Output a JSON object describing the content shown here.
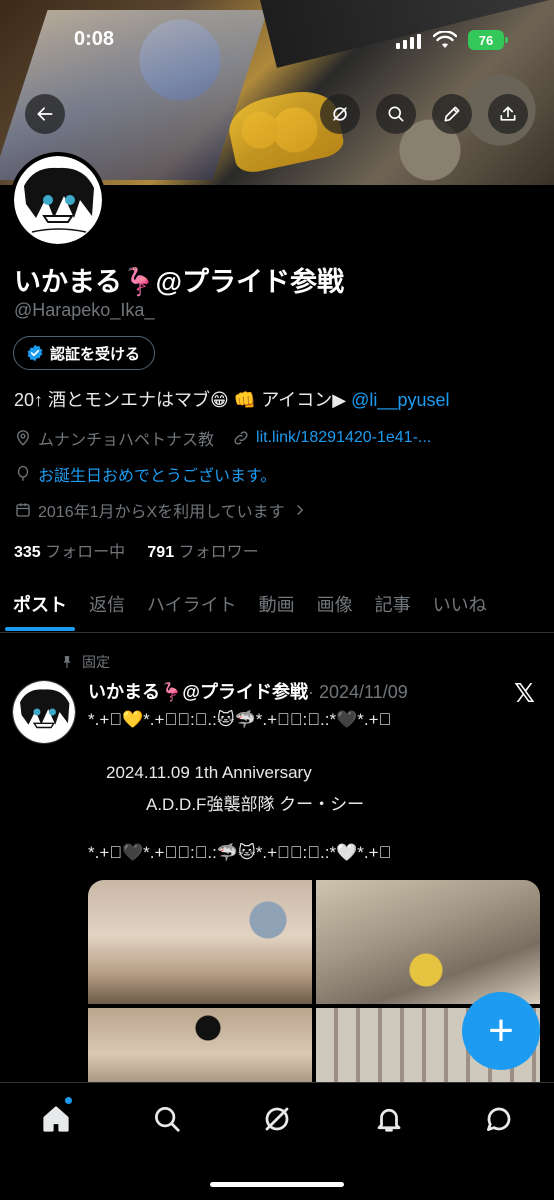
{
  "status_bar": {
    "time": "0:08",
    "battery": "76"
  },
  "header": {
    "buttons": [
      "back-icon",
      "grok-icon",
      "search-icon",
      "edit-icon",
      "share-icon"
    ]
  },
  "profile": {
    "name": "いかまる🦩@プライド参戦",
    "handle": "@Harapeko_Ika_",
    "verify_label": "認証を受ける",
    "bio_text": "20↑ 酒とモンエナはマブ😁 👊 アイコン▶︎ ",
    "bio_link": "@li__pyusel",
    "location": "ムナンチョハペトナス教",
    "website": "lit.link/18291420-1e41-...",
    "birthday": "お誕生日おめでとうございます。",
    "joined": "2016年1月からXを利用しています",
    "following_count": "335",
    "following_label": "フォロー中",
    "followers_count": "791",
    "followers_label": "フォロワー"
  },
  "tabs": [
    "ポスト",
    "返信",
    "ハイライト",
    "動画",
    "画像",
    "記事",
    "いいね"
  ],
  "active_tab": "ポスト",
  "post": {
    "pinned_label": "固定",
    "author": "いかまる🦩@プライド参戦",
    "date": "· 2024/11/09",
    "line1": "*.+ﾟ💛*.+ﾟ｡:ﾟ.:🐱🦈*.+ﾟ｡:ﾟ.:*🖤*.+ﾟ",
    "line2": "2024.11.09 1th Anniversary",
    "line3": "A.D.D.F強襲部隊 クー・シー",
    "line4": "*.+ﾟ🖤*.+ﾟ｡:ﾟ.:🦈🐱*.+ﾟ｡:ﾟ.:*🤍*.+ﾟ"
  },
  "fab_label": "+",
  "bottom_nav": [
    "home-icon",
    "search-icon",
    "grok-icon",
    "notifications-icon",
    "messages-icon"
  ],
  "colors": {
    "accent": "#1d9bf0",
    "muted": "#71767b",
    "background": "#000000"
  }
}
